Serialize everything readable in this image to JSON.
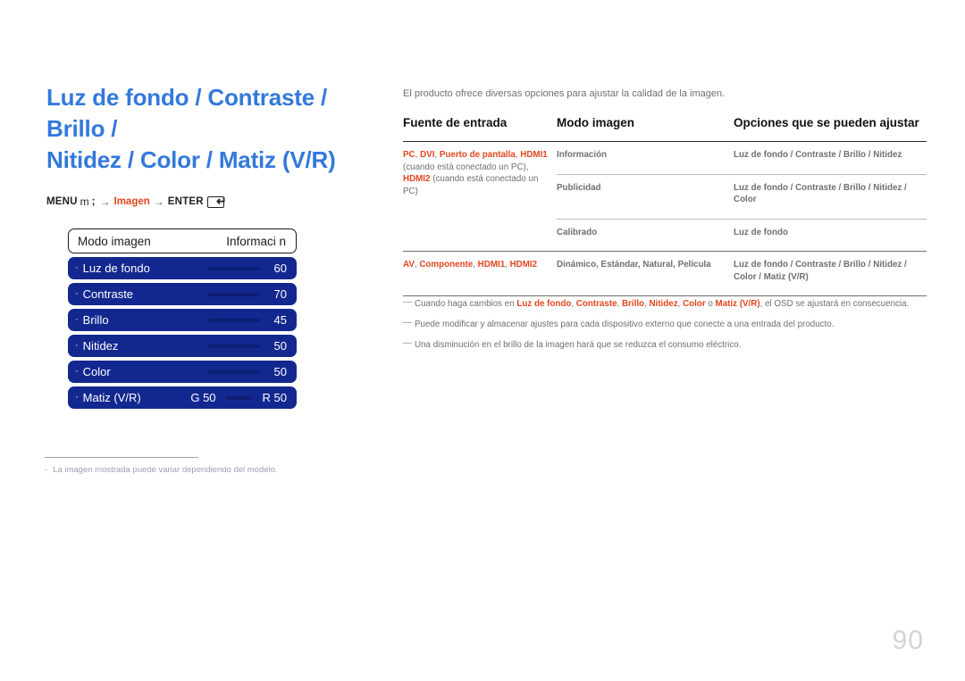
{
  "page": {
    "title": "Luz de fondo / Contraste / Brillo /\nNitidez / Color / Matiz (V/R)",
    "number": "90",
    "title_color": "#3379dc",
    "accent_color": "#e2461e",
    "osd_color": "#13288f"
  },
  "menu_path": {
    "menu_label": "MENU",
    "menu_icon": "menu-glyph-m",
    "separator": ";",
    "arrow": "→",
    "target": "Imagen",
    "enter_label": "ENTER",
    "enter_icon": "enter-return-arrow"
  },
  "osd": {
    "header": {
      "label": "Modo imagen",
      "value": "Informaci n"
    },
    "rows": [
      {
        "bullet": "·",
        "label": "Luz de fondo",
        "value": "60",
        "has_bar": true
      },
      {
        "bullet": "·",
        "label": "Contraste",
        "value": "70",
        "has_bar": true
      },
      {
        "bullet": "·",
        "label": "Brillo",
        "value": "45",
        "has_bar": true
      },
      {
        "bullet": "·",
        "label": "Nitidez",
        "value": "50",
        "has_bar": true
      },
      {
        "bullet": "·",
        "label": "Color",
        "value": "50",
        "has_bar": true
      }
    ],
    "tint_row": {
      "bullet": "·",
      "label": "Matiz (V/R)",
      "green_value": "G 50",
      "red_value": "R 50"
    }
  },
  "left_footnote": {
    "dash": "-",
    "text": "La imagen mostrada puede variar dependiendo del modelo."
  },
  "right": {
    "intro": "El producto ofrece diversas opciones para ajustar la calidad de la imagen.",
    "table": {
      "headers": [
        "Fuente de entrada",
        "Modo imagen",
        "Opciones que se pueden ajustar"
      ],
      "group1": {
        "source_parts": [
          {
            "text": "PC",
            "orange": true
          },
          {
            "text": ", ",
            "orange": false
          },
          {
            "text": "DVI",
            "orange": true
          },
          {
            "text": ", ",
            "orange": false
          },
          {
            "text": "Puerto de pantalla",
            "orange": true
          },
          {
            "text": ", ",
            "orange": false
          },
          {
            "text": "HDMI1",
            "orange": true
          },
          {
            "text": " (cuando está conectado un PC), ",
            "orange": false
          },
          {
            "text": "HDMI2",
            "orange": true
          },
          {
            "text": " (cuando está conectado un PC)",
            "orange": false
          }
        ],
        "rows": [
          {
            "mode": "Información",
            "options": "Luz de fondo / Contraste / Brillo / Nitidez"
          },
          {
            "mode": "Publicidad",
            "options": "Luz de fondo / Contraste / Brillo / Nitidez / Color"
          },
          {
            "mode": "Calibrado",
            "options": "Luz de fondo"
          }
        ]
      },
      "group2": {
        "source_parts": [
          {
            "text": "AV",
            "orange": true
          },
          {
            "text": ", ",
            "orange": false
          },
          {
            "text": "Componente",
            "orange": true
          },
          {
            "text": ", ",
            "orange": false
          },
          {
            "text": "HDMI1",
            "orange": true
          },
          {
            "text": ", ",
            "orange": false
          },
          {
            "text": "HDMI2",
            "orange": true
          }
        ],
        "rows": [
          {
            "mode": "Dinámico, Estándar, Natural, Película",
            "options": "Luz de fondo / Contraste / Brillo / Nitidez / Color / Matiz (V/R)"
          }
        ]
      }
    },
    "notes": [
      {
        "dash": "—",
        "parts": [
          {
            "text": "Cuando haga cambios en ",
            "orange": false
          },
          {
            "text": "Luz de fondo",
            "orange": true
          },
          {
            "text": ", ",
            "orange": false
          },
          {
            "text": "Contraste",
            "orange": true
          },
          {
            "text": ", ",
            "orange": false
          },
          {
            "text": "Brillo",
            "orange": true
          },
          {
            "text": ", ",
            "orange": false
          },
          {
            "text": "Nitidez",
            "orange": true
          },
          {
            "text": ", ",
            "orange": false
          },
          {
            "text": "Color",
            "orange": true
          },
          {
            "text": " o ",
            "orange": false
          },
          {
            "text": "Matiz (V/R)",
            "orange": true
          },
          {
            "text": ", el OSD se ajustará en consecuencia.",
            "orange": false
          }
        ]
      },
      {
        "dash": "—",
        "parts": [
          {
            "text": "Puede modificar y almacenar ajustes para cada dispositivo externo que conecte a una entrada del producto.",
            "orange": false
          }
        ]
      },
      {
        "dash": "—",
        "parts": [
          {
            "text": "Una disminución en el brillo de la imagen hará que se reduzca el consumo eléctrico.",
            "orange": false
          }
        ]
      }
    ]
  }
}
